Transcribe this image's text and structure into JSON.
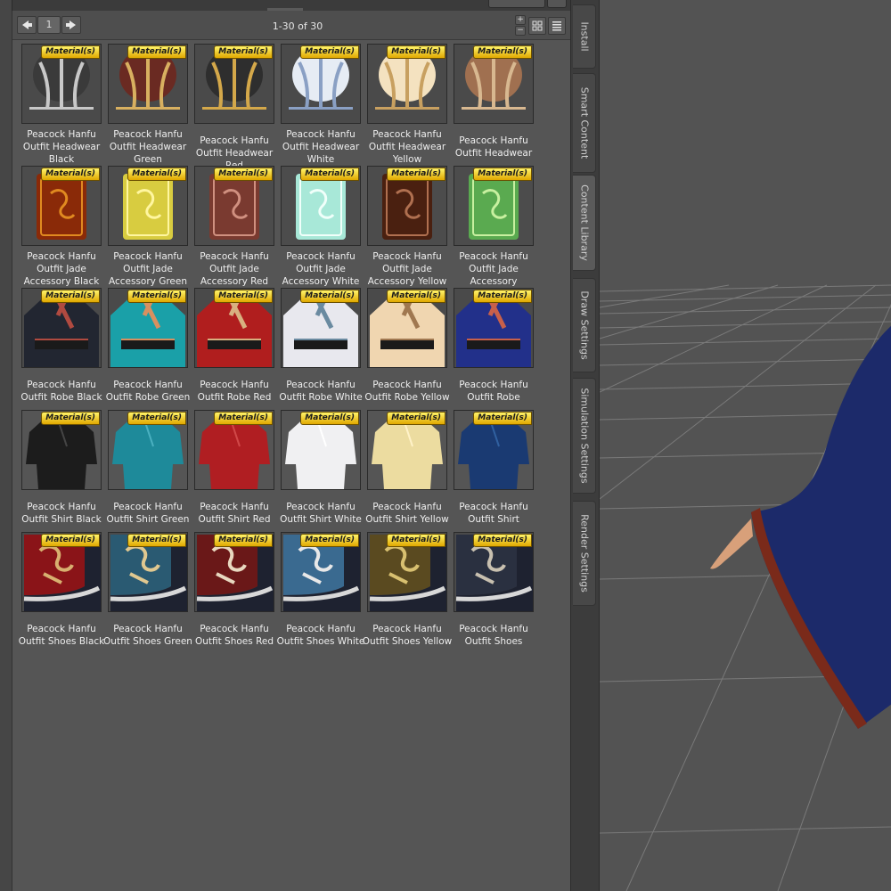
{
  "toolbar": {
    "page_number": "1",
    "prev_icon": "arrow-left-icon",
    "next_icon": "arrow-right-icon",
    "page_count": "1-30 of 30",
    "zoom_in": "+",
    "zoom_out": "−",
    "icon_view": "grid-view-icon",
    "list_view": "list-view-icon"
  },
  "badge_text": "Material(s)",
  "items": [
    {
      "name": "Peacock Hanfu Outfit Headwear Black",
      "kind": "headwear",
      "color": "#3a3a3a",
      "accent": "#c8c8c8"
    },
    {
      "name": "Peacock Hanfu Outfit Headwear Green",
      "kind": "headwear",
      "color": "#6a2a22",
      "accent": "#d8b060"
    },
    {
      "name": "Peacock Hanfu Outfit Headwear Red",
      "kind": "headwear",
      "color": "#2e2e2e",
      "accent": "#d4a84a"
    },
    {
      "name": "Peacock Hanfu Outfit Headwear White",
      "kind": "headwear",
      "color": "#e6ecf4",
      "accent": "#8aa0c4"
    },
    {
      "name": "Peacock Hanfu Outfit Headwear Yellow",
      "kind": "headwear",
      "color": "#f4e2c0",
      "accent": "#c8a060"
    },
    {
      "name": "Peacock Hanfu Outfit Headwear",
      "kind": "headwear",
      "color": "#a07050",
      "accent": "#d8b890"
    },
    {
      "name": "Peacock Hanfu Outfit Jade Accessory Black",
      "kind": "jade",
      "color": "#8a2a08",
      "accent": "#e08a20"
    },
    {
      "name": "Peacock Hanfu Outfit Jade Accessory Green",
      "kind": "jade",
      "color": "#d8cc40",
      "accent": "#fff6a0"
    },
    {
      "name": "Peacock Hanfu Outfit Jade Accessory Red",
      "kind": "jade",
      "color": "#7a3a30",
      "accent": "#d09080"
    },
    {
      "name": "Peacock Hanfu Outfit Jade Accessory White",
      "kind": "jade",
      "color": "#a8e8d8",
      "accent": "#f0fffa"
    },
    {
      "name": "Peacock Hanfu Outfit Jade Accessory Yellow",
      "kind": "jade",
      "color": "#4a2010",
      "accent": "#b07050"
    },
    {
      "name": "Peacock Hanfu Outfit Jade Accessory",
      "kind": "jade",
      "color": "#5aaa50",
      "accent": "#c8f0a0"
    },
    {
      "name": "Peacock Hanfu Outfit Robe Black",
      "kind": "robe",
      "color": "#222631",
      "accent": "#b04a40"
    },
    {
      "name": "Peacock Hanfu Outfit Robe Green",
      "kind": "robe",
      "color": "#1aa0a8",
      "accent": "#d89060"
    },
    {
      "name": "Peacock Hanfu Outfit Robe Red",
      "kind": "robe",
      "color": "#b01e1e",
      "accent": "#d8b080"
    },
    {
      "name": "Peacock Hanfu Outfit Robe White",
      "kind": "robe",
      "color": "#e8e8ee",
      "accent": "#6a8aa0"
    },
    {
      "name": "Peacock Hanfu Outfit Robe Yellow",
      "kind": "robe",
      "color": "#f0d6b0",
      "accent": "#a07850"
    },
    {
      "name": "Peacock Hanfu Outfit Robe",
      "kind": "robe",
      "color": "#22308a",
      "accent": "#c8604a"
    },
    {
      "name": "Peacock Hanfu Outfit Shirt Black",
      "kind": "shirt",
      "color": "#1c1c1c",
      "accent": "#444"
    },
    {
      "name": "Peacock Hanfu Outfit Shirt Green",
      "kind": "shirt",
      "color": "#1e8a9a",
      "accent": "#4ab0c0"
    },
    {
      "name": "Peacock Hanfu Outfit Shirt Red",
      "kind": "shirt",
      "color": "#b01e22",
      "accent": "#d04848"
    },
    {
      "name": "Peacock Hanfu Outfit Shirt White",
      "kind": "shirt",
      "color": "#f0f0f2",
      "accent": "#ffffff"
    },
    {
      "name": "Peacock Hanfu Outfit Shirt Yellow",
      "kind": "shirt",
      "color": "#ecdca0",
      "accent": "#fff2c8"
    },
    {
      "name": "Peacock Hanfu Outfit Shirt",
      "kind": "shirt",
      "color": "#1a3a72",
      "accent": "#3060a0"
    },
    {
      "name": "Peacock Hanfu Outfit Shoes Black",
      "kind": "shoes",
      "color": "#8a1418",
      "accent": "#d8b070"
    },
    {
      "name": "Peacock Hanfu Outfit Shoes Green",
      "kind": "shoes",
      "color": "#2a5a72",
      "accent": "#e0c890"
    },
    {
      "name": "Peacock Hanfu Outfit Shoes Red",
      "kind": "shoes",
      "color": "#6a1818",
      "accent": "#e8d8c0"
    },
    {
      "name": "Peacock Hanfu Outfit Shoes White",
      "kind": "shoes",
      "color": "#3a6a90",
      "accent": "#e8e8e8"
    },
    {
      "name": "Peacock Hanfu Outfit Shoes Yellow",
      "kind": "shoes",
      "color": "#5a4a20",
      "accent": "#d8c070"
    },
    {
      "name": "Peacock Hanfu Outfit Shoes",
      "kind": "shoes",
      "color": "#2a3040",
      "accent": "#c8c0b0"
    }
  ],
  "side_tabs": [
    {
      "label": "Install",
      "active": false
    },
    {
      "label": "Smart Content",
      "active": false
    },
    {
      "label": "Content Library",
      "active": true
    },
    {
      "label": "Draw Settings",
      "active": false
    },
    {
      "label": "Simulation Settings",
      "active": false
    },
    {
      "label": "Render Settings",
      "active": false
    }
  ],
  "viewport": {
    "background": "#535353",
    "grid_color": "#7a7a7a",
    "robe_color": "#1c2a6a",
    "trim_color": "#7a2a1a",
    "skin_color": "#d8a07a"
  }
}
